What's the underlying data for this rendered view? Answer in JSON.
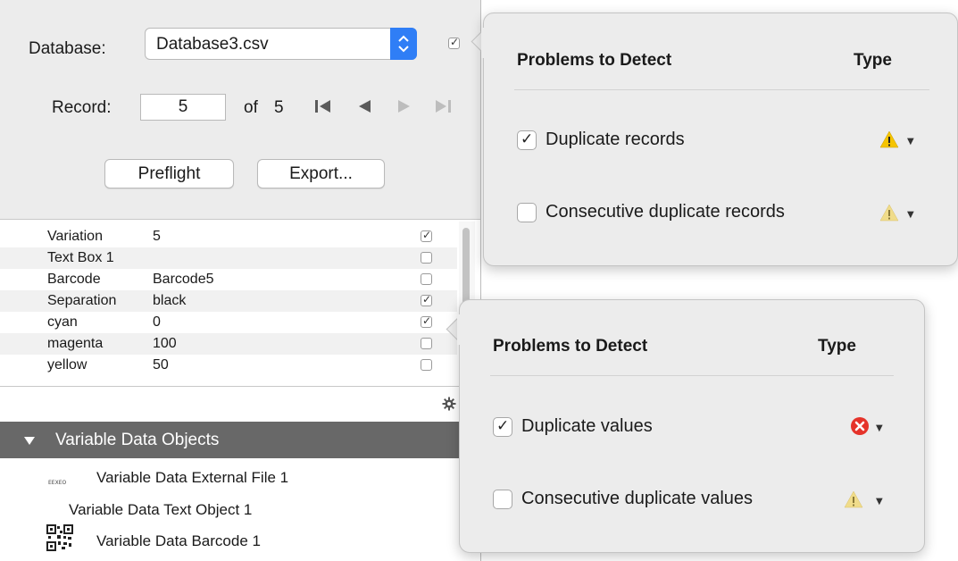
{
  "database": {
    "label": "Database:",
    "value": "Database3.csv",
    "checked": true
  },
  "record": {
    "label": "Record:",
    "value": "5",
    "of_label": "of",
    "total": "5"
  },
  "buttons": {
    "preflight": "Preflight",
    "export": "Export..."
  },
  "table": {
    "rows": [
      {
        "name": "Variation",
        "value": "5",
        "checked": true
      },
      {
        "name": "Text Box 1",
        "value": "",
        "checked": false
      },
      {
        "name": "Barcode",
        "value": "Barcode5",
        "checked": false
      },
      {
        "name": "Separation",
        "value": "black",
        "checked": true
      },
      {
        "name": "cyan",
        "value": "0",
        "checked": true
      },
      {
        "name": "magenta",
        "value": "100",
        "checked": false
      },
      {
        "name": "yellow",
        "value": "50",
        "checked": false
      }
    ]
  },
  "vdo": {
    "title": "Variable Data Objects",
    "items": [
      {
        "label": "Variable Data External File 1",
        "icon": "external-file-icon",
        "icon_text": "EEXEO"
      },
      {
        "label": "Variable Data Text Object 1",
        "icon": ""
      },
      {
        "label": "Variable Data Barcode 1",
        "icon": "qr-code-icon"
      }
    ]
  },
  "popover_records": {
    "header": "Problems to Detect",
    "type_header": "Type",
    "options": [
      {
        "label": "Duplicate records",
        "checked": true,
        "type": "warning",
        "type_color": "#f5c400"
      },
      {
        "label": "Consecutive duplicate records",
        "checked": false,
        "type": "warning",
        "type_color": "#f0dc8a"
      }
    ]
  },
  "popover_values": {
    "header": "Problems to Detect",
    "type_header": "Type",
    "options": [
      {
        "label": "Duplicate values",
        "checked": true,
        "type": "error",
        "type_color": "#e5332a"
      },
      {
        "label": "Consecutive duplicate values",
        "checked": false,
        "type": "warning",
        "type_color": "#f0dc8a"
      }
    ]
  },
  "colors": {
    "accent": "#2f7ef6",
    "section_header": "#686868"
  }
}
